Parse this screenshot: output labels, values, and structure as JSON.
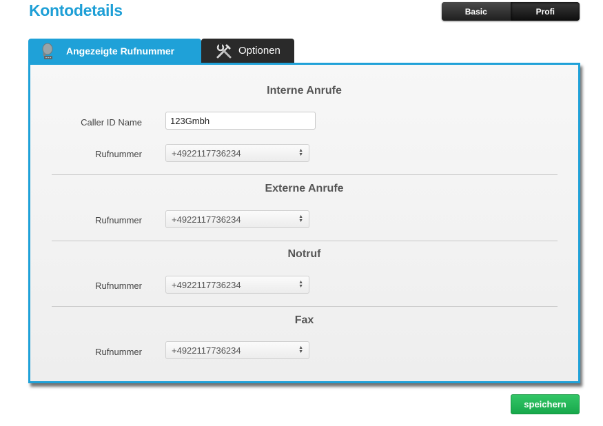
{
  "page": {
    "title": "Kontodetails"
  },
  "mode_switch": {
    "basic": "Basic",
    "profi": "Profi"
  },
  "tabs": [
    {
      "label": "Angezeigte Rufnummer",
      "icon": "phone-head-icon"
    },
    {
      "label": "Optionen",
      "icon": "tools-icon"
    }
  ],
  "sections": {
    "internal": {
      "title": "Interne Anrufe",
      "caller_id_label": "Caller ID Name",
      "caller_id_value": "123Gmbh",
      "number_label": "Rufnummer",
      "number_value": "+4922117736234"
    },
    "external": {
      "title": "Externe Anrufe",
      "number_label": "Rufnummer",
      "number_value": "+4922117736234"
    },
    "emergency": {
      "title": "Notruf",
      "number_label": "Rufnummer",
      "number_value": "+4922117736234"
    },
    "fax": {
      "title": "Fax",
      "number_label": "Rufnummer",
      "number_value": "+4922117736234"
    }
  },
  "actions": {
    "save": "speichern"
  },
  "colors": {
    "accent": "#1fa1d8",
    "save": "#1fb251",
    "dark_tab": "#2a2a2a"
  }
}
